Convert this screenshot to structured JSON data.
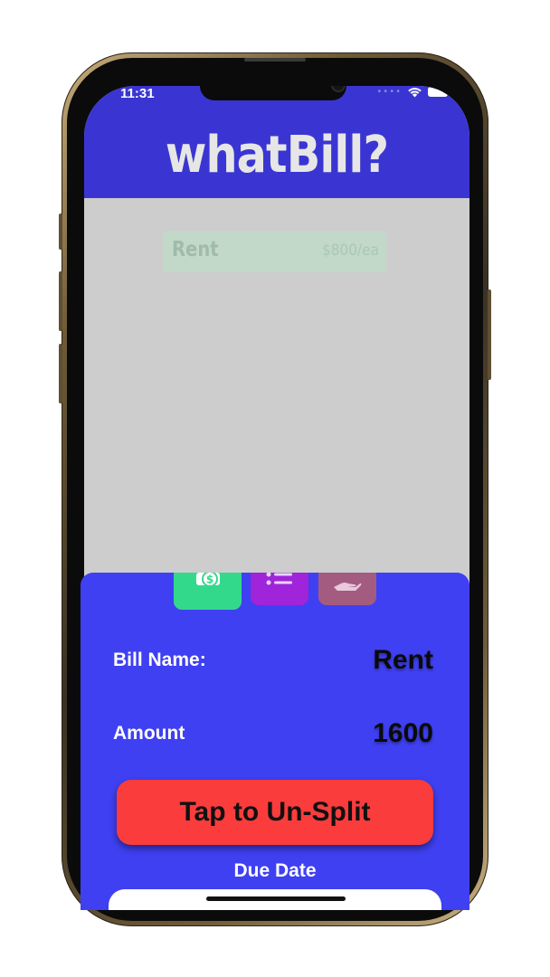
{
  "status_bar": {
    "time": "11:31"
  },
  "header": {
    "title": "whatBill?"
  },
  "bills": [
    {
      "name": "Rent",
      "amount": "$800/ea"
    }
  ],
  "tabs": [
    {
      "icon": "money-icon"
    },
    {
      "icon": "list-icon"
    },
    {
      "icon": "hand-icon"
    }
  ],
  "form": {
    "bill_name_label": "Bill Name:",
    "bill_name_value": "Rent",
    "amount_label": "Amount",
    "amount_value": "1600",
    "unsplit_label": "Tap to Un-Split",
    "due_date_label": "Due Date"
  },
  "colors": {
    "header": "#3a35d2",
    "sheet": "#3f40f2",
    "unsplit_button": "#fa3c3c",
    "tab_money": "#33d98b",
    "tab_list": "#a024d9",
    "tab_hand": "#a35c80"
  }
}
